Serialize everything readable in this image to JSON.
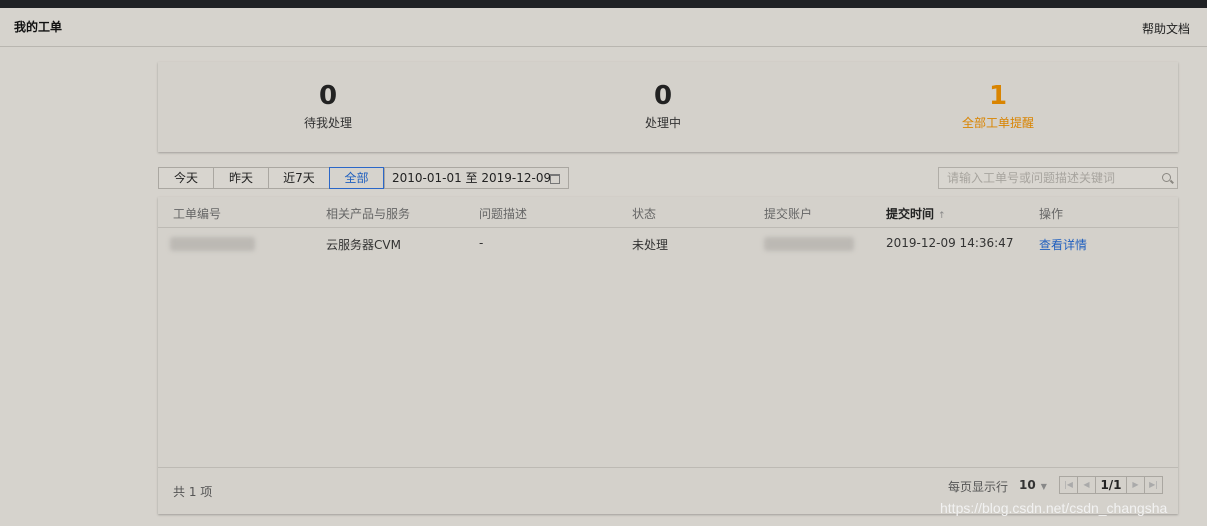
{
  "header": {
    "title": "我的工单",
    "help": "帮助文档"
  },
  "stats": [
    {
      "value": "0",
      "label": "待我处理"
    },
    {
      "value": "0",
      "label": "处理中"
    },
    {
      "value": "1",
      "label": "全部工单提醒"
    }
  ],
  "filters": {
    "buttons": [
      "今天",
      "昨天",
      "近7天",
      "全部"
    ],
    "active": "全部",
    "date_range": "2010-01-01 至 2019-12-09"
  },
  "search": {
    "placeholder": "请输入工单号或问题描述关键词",
    "value": ""
  },
  "table": {
    "columns": [
      "工单编号",
      "相关产品与服务",
      "问题描述",
      "状态",
      "提交账户",
      "提交时间",
      "操作"
    ],
    "sorted_column": "提交时间",
    "rows": [
      {
        "id": "",
        "product": "云服务器CVM",
        "description": "-",
        "status": "未处理",
        "account": "",
        "submitted": "2019-12-09 14:36:47",
        "action": "查看详情"
      }
    ]
  },
  "footer": {
    "total": "共 1 项",
    "per_page_label": "每页显示行",
    "per_page": "10",
    "page": "1/1"
  },
  "watermark": "https://blog.csdn.net/csdn_changsha",
  "colors": {
    "accent_orange": "#d98400",
    "link_blue": "#1f5fbf",
    "background": "#d6d3cd"
  }
}
